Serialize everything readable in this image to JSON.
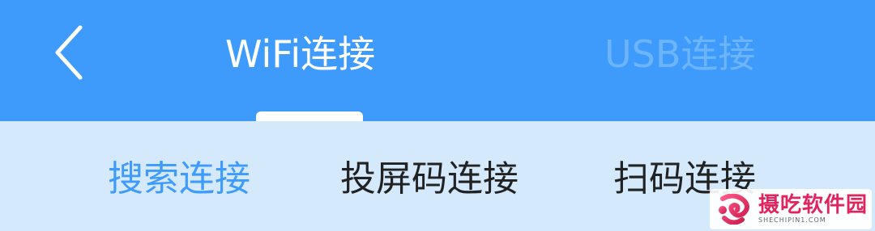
{
  "header": {
    "back_icon": "chevron-left-icon",
    "tabs": [
      {
        "label": "WiFi连接",
        "active": true
      },
      {
        "label": "USB连接",
        "active": false
      }
    ]
  },
  "subtabs": [
    {
      "label": "搜索连接",
      "active": true
    },
    {
      "label": "投屏码连接",
      "active": false
    },
    {
      "label": "扫码连接",
      "active": false
    }
  ],
  "watermark": {
    "name": "摄吃软件园",
    "url": "SHECHIPIN1.COM"
  },
  "colors": {
    "header_bg": "#3f9bfb",
    "subbar_bg": "#d5e9fc",
    "active_subtab": "#3f9bfb",
    "inactive_tab": "#6cb4fc"
  }
}
